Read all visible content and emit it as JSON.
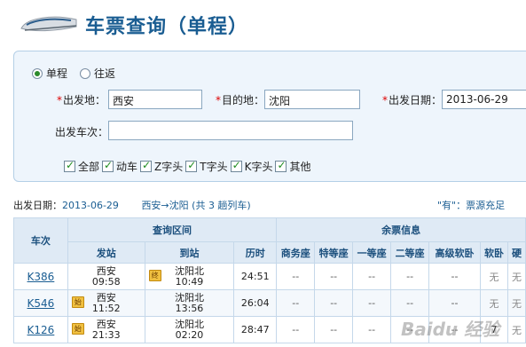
{
  "header": {
    "title": "车票查询（单程）",
    "logo_icon": "high-speed-train-icon"
  },
  "trip_type": {
    "options": [
      "单程",
      "往返"
    ],
    "selected": "单程"
  },
  "form": {
    "from_label": "出发地：",
    "from_value": "西安",
    "to_label": "目的地：",
    "to_value": "沈阳",
    "date_label": "出发日期：",
    "date_value": "2013-06-29",
    "train_no_label": "出发车次：",
    "train_no_value": ""
  },
  "filters": [
    "全部",
    "动车",
    "Z字头",
    "T字头",
    "K字头",
    "其他"
  ],
  "summary": {
    "date_label": "出发日期：",
    "date_value": "2013-06-29",
    "route": "西安→沈阳 (共 3 趟列车)",
    "legend": "\"有\"：票源充足"
  },
  "table": {
    "header_row1": {
      "train_no": "车次",
      "query_section": "查询区间",
      "seat_info": "余票信息"
    },
    "header_row2": {
      "depart": "发站",
      "arrive": "到站",
      "duration": "历时",
      "seats": [
        "商务座",
        "特等座",
        "一等座",
        "二等座",
        "高级软卧",
        "软卧",
        "硬"
      ]
    },
    "rows": [
      {
        "train": "K386",
        "dep_station": "西安",
        "dep_time": "09:58",
        "dep_tag": "",
        "arr_station": "沈阳北",
        "arr_time": "10:49",
        "arr_tag": "终",
        "duration": "24:51",
        "seats": [
          "--",
          "--",
          "--",
          "--",
          "--",
          "无",
          "无"
        ]
      },
      {
        "train": "K546",
        "dep_station": "西安",
        "dep_time": "11:52",
        "dep_tag": "始",
        "arr_station": "沈阳北",
        "arr_time": "13:56",
        "arr_tag": "",
        "duration": "26:04",
        "seats": [
          "--",
          "--",
          "--",
          "--",
          "--",
          "无",
          "无"
        ]
      },
      {
        "train": "K126",
        "dep_station": "西安",
        "dep_time": "21:33",
        "dep_tag": "始",
        "arr_station": "沈阳北",
        "arr_time": "02:20",
        "arr_tag": "",
        "duration": "28:47",
        "seats": [
          "--",
          "--",
          "--",
          "--",
          "--",
          "7",
          "无"
        ]
      }
    ]
  },
  "watermark": "Baidu 经验"
}
